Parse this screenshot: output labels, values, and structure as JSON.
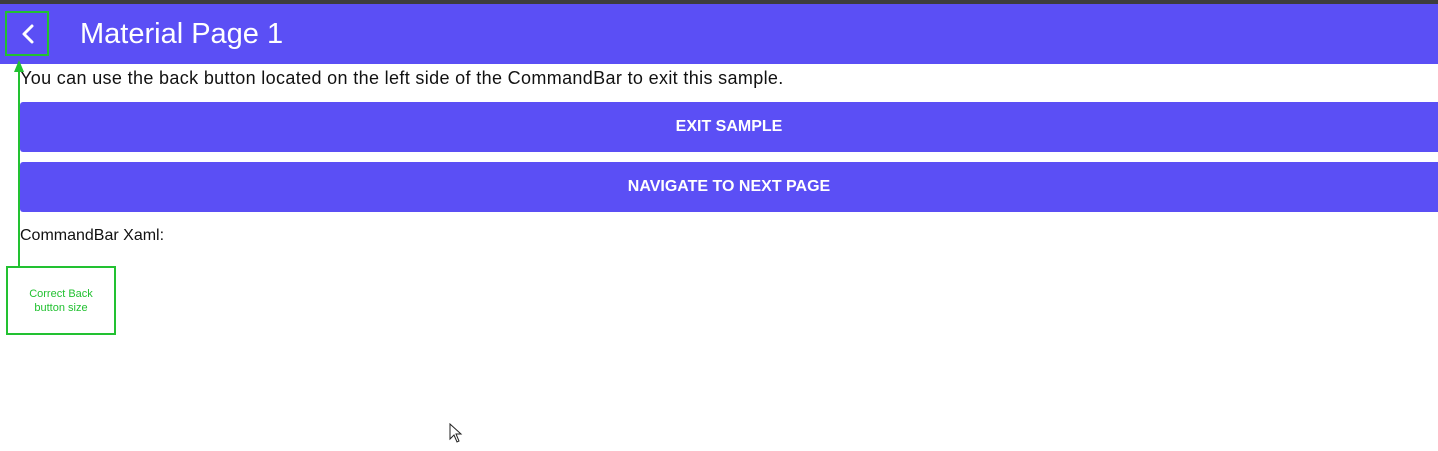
{
  "command_bar": {
    "title": "Material Page 1",
    "back_icon": "chevron-left-icon",
    "background_color": "#5b4ff5"
  },
  "content": {
    "description": "You can use the back button located on the left side of the CommandBar to exit this sample.",
    "exit_button_label": "EXIT SAMPLE",
    "next_button_label": "NAVIGATE TO NEXT PAGE",
    "xaml_label": "CommandBar Xaml:"
  },
  "annotation": {
    "text": "Correct Back button size",
    "color": "#22c131"
  }
}
